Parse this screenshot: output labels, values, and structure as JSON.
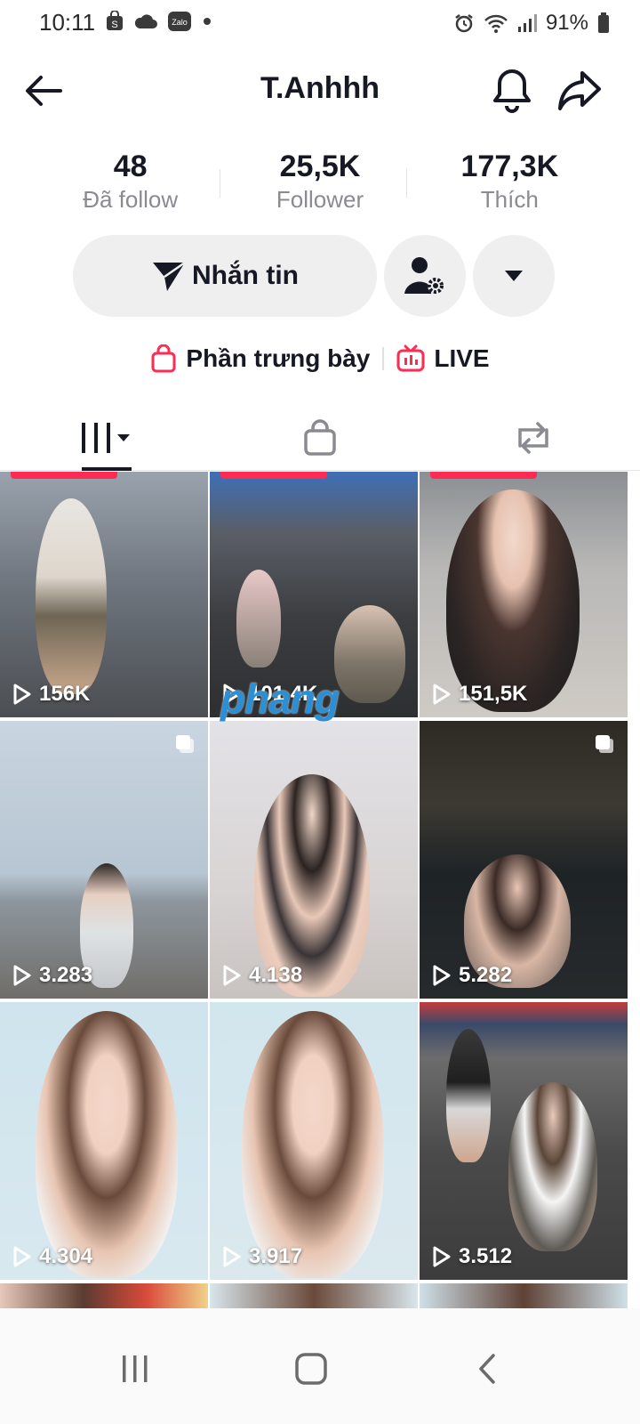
{
  "status_bar": {
    "time": "10:11",
    "battery": "91%",
    "left_icons": [
      "shop-icon",
      "cloud-icon",
      "zalo-icon",
      "dot-icon"
    ],
    "right_icons": [
      "alarm-icon",
      "wifi-icon",
      "signal-icon",
      "battery-icon"
    ]
  },
  "header": {
    "title": "T.Anhhh"
  },
  "stats": [
    {
      "value": "48",
      "label": "Đã follow"
    },
    {
      "value": "25,5K",
      "label": "Follower"
    },
    {
      "value": "177,3K",
      "label": "Thích"
    }
  ],
  "actions": {
    "message_label": "Nhắn tin"
  },
  "links": {
    "showcase_label": "Phần trưng bày",
    "live_label": "LIVE"
  },
  "videos": [
    {
      "views": "156K",
      "pinned": true,
      "multi": false
    },
    {
      "views": "101,4K",
      "pinned": true,
      "multi": false
    },
    {
      "views": "151,5K",
      "pinned": true,
      "multi": false
    },
    {
      "views": "3.283",
      "pinned": false,
      "multi": true
    },
    {
      "views": "4.138",
      "pinned": false,
      "multi": false
    },
    {
      "views": "5.282",
      "pinned": false,
      "multi": true
    },
    {
      "views": "4.304",
      "pinned": false,
      "multi": false
    },
    {
      "views": "3.917",
      "pinned": false,
      "multi": false
    },
    {
      "views": "3.512",
      "pinned": false,
      "multi": false
    }
  ],
  "watermark": "phang",
  "colors": {
    "accent": "#fe2c55",
    "text": "#161823",
    "secondary_text": "#8a8b91",
    "button_bg": "#efeff0"
  }
}
